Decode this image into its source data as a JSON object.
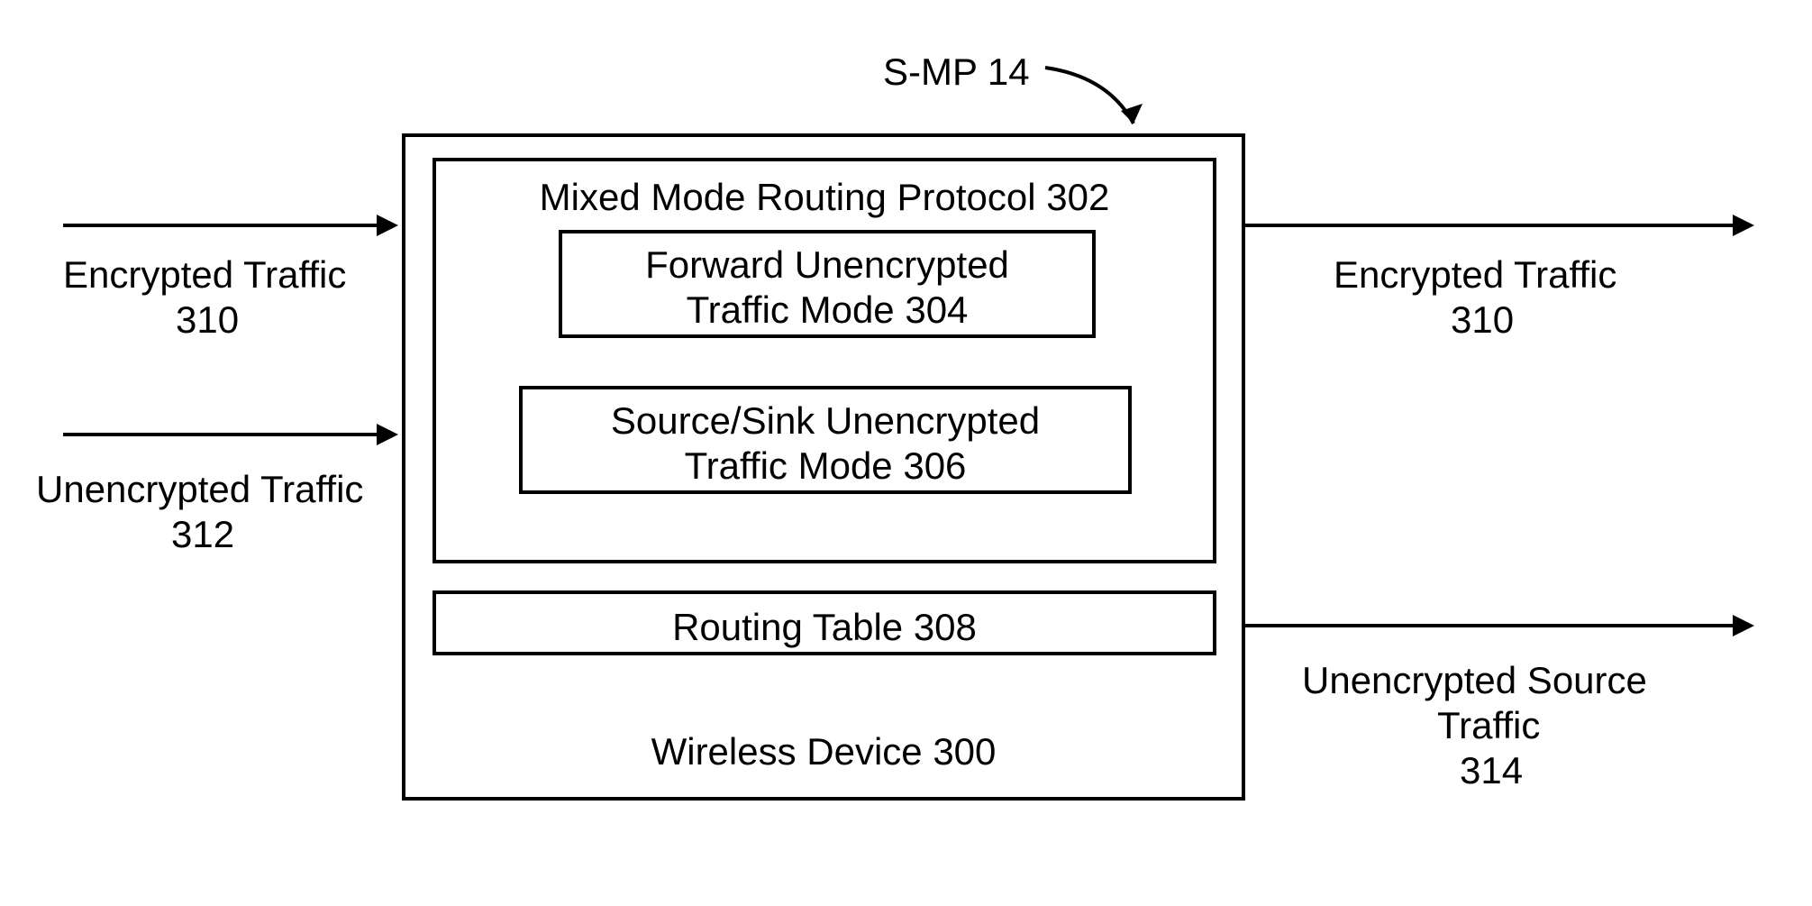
{
  "topLabel": "S-MP 14",
  "leftInputs": {
    "encrypted": {
      "line1": "Encrypted Traffic",
      "line2": "310"
    },
    "unencrypted": {
      "line1": "Unencrypted Traffic",
      "line2": "312"
    }
  },
  "rightOutputs": {
    "encrypted": {
      "line1": "Encrypted Traffic",
      "line2": "310"
    },
    "unencryptedSource": {
      "line1": "Unencrypted Source",
      "line2": "Traffic",
      "line3": "314"
    }
  },
  "mainBox": {
    "wirelessDevice": "Wireless Device 300",
    "mixedMode": "Mixed Mode Routing Protocol 302",
    "forwardMode": {
      "line1": "Forward Unencrypted",
      "line2": "Traffic Mode 304"
    },
    "sourceSinkMode": {
      "line1": "Source/Sink Unencrypted",
      "line2": "Traffic Mode 306"
    },
    "routingTable": "Routing Table 308"
  }
}
